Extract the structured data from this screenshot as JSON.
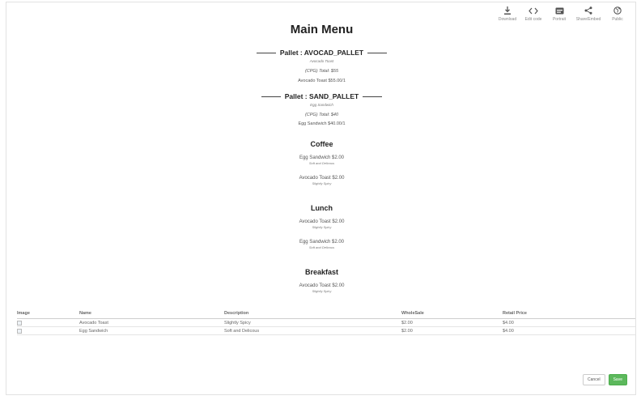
{
  "toolbar": [
    {
      "label": "Download",
      "icon": "download-icon"
    },
    {
      "label": "Edit code",
      "icon": "code-icon"
    },
    {
      "label": "Portrait",
      "icon": "portrait-icon"
    },
    {
      "label": "Share/Embed",
      "icon": "share-icon"
    },
    {
      "label": "Public",
      "icon": "globe-icon"
    }
  ],
  "menu": {
    "title": "Main Menu",
    "pallets": [
      {
        "name": "Pallet : AVOCAD_PALLET",
        "item_small": "Avocado Toast",
        "total": "(CPG) Total: $55",
        "line": "Avocado Toast $55.00/1"
      },
      {
        "name": "Pallet : SAND_PALLET",
        "item_small": "Egg Sandwich",
        "total": "(CPG) Total: $40",
        "line": "Egg Sandwich $40.00/1"
      }
    ],
    "sections": [
      {
        "name": "Coffee",
        "items": [
          {
            "name": "Egg Sandwich $2.00",
            "desc": "Soft and Delicous"
          },
          {
            "name": "Avocado Toast $2.00",
            "desc": "Slightly Spicy"
          }
        ]
      },
      {
        "name": "Lunch",
        "items": [
          {
            "name": "Avocado Toast $2.00",
            "desc": "Slightly Spicy"
          },
          {
            "name": "Egg Sandwich $2.00",
            "desc": "Soft and Delicous"
          }
        ]
      },
      {
        "name": "Breakfast",
        "items": [
          {
            "name": "Avocado Toast $2.00",
            "desc": "Slightly Spicy"
          }
        ]
      }
    ]
  },
  "table": {
    "headers": [
      "Image",
      "Name",
      "Description",
      "WholeSale",
      "Retail Price"
    ],
    "rows": [
      [
        "",
        "Avocado Toast",
        "Slightly Spicy",
        "$2.00",
        "$4.00"
      ],
      [
        "",
        "Egg Sandwich",
        "Soft and Delicous",
        "$2.00",
        "$4.00"
      ]
    ]
  },
  "buttons": {
    "cancel": "Cancel",
    "save": "Save"
  },
  "colors": {
    "save": "#5cb85c"
  }
}
